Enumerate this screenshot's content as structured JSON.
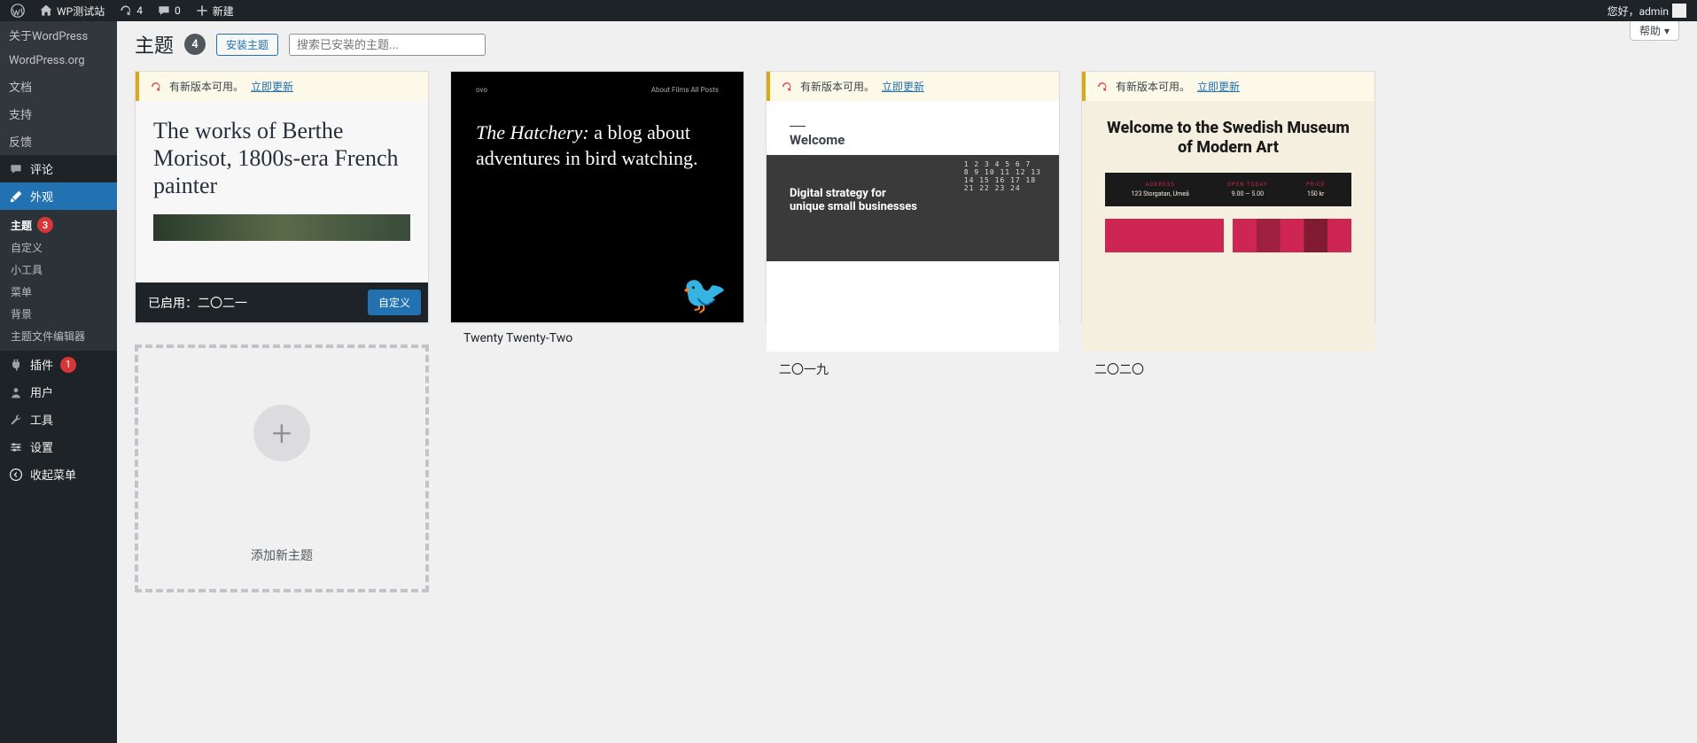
{
  "adminbar": {
    "site": "WP测试站",
    "updates": "4",
    "comments": "0",
    "newLabel": "新建",
    "greeting": "您好，admin"
  },
  "popover": {
    "about": "关于WordPress",
    "org": "WordPress.org",
    "docs": "文档",
    "support": "支持",
    "feedback": "反馈"
  },
  "sidebar": {
    "comments": "评论",
    "appearance": "外观",
    "themesLabel": "主题",
    "themesBadge": "3",
    "customize": "自定义",
    "widgets": "小工具",
    "menus": "菜单",
    "background": "背景",
    "editor": "主题文件编辑器",
    "plugins": "插件",
    "pluginsBadge": "1",
    "users": "用户",
    "tools": "工具",
    "settings": "设置",
    "collapse": "收起菜单"
  },
  "page": {
    "title": "主题",
    "count": "4",
    "install": "安装主题",
    "searchPlaceholder": "搜索已安装的主题...",
    "help": "帮助"
  },
  "updateBanner": {
    "msg": "有新版本可用。",
    "link": "立即更新"
  },
  "themes": [
    {
      "activePrefix": "已启用：",
      "name": "二〇二一",
      "customize": "自定义",
      "preview": {
        "text": "The works of Berthe Morisot, 1800s-era French painter"
      }
    },
    {
      "name": "Twenty Twenty-Two",
      "preview": {
        "navLeft": "ovo",
        "navRight": "About    Films    All Posts",
        "hatchEm": "The Hatchery:",
        "hatchRest": " a blog about adventures in bird watching."
      }
    },
    {
      "name": "二〇一九",
      "preview": {
        "welcome": "Welcome",
        "heroLine1": "Digital strategy for",
        "heroLine2": "unique small businesses",
        "calLine1": "1 2 3 4 5 6 7",
        "calLine2": "8 9 10 11 12 13",
        "calLine3": "14 15 16 17 18",
        "calLine4": "21 22 23 24"
      }
    },
    {
      "name": "二〇二〇",
      "preview": {
        "title": "Welcome to the Swedish Museum of Modern Art",
        "col1l": "ADDRESS",
        "col1v": "123 Storgatan, Umeå",
        "col2l": "OPEN TODAY",
        "col2v": "9.00 — 5.00",
        "col3l": "PRICE",
        "col3v": "150 kr"
      }
    }
  ],
  "addNew": "添加新主题"
}
